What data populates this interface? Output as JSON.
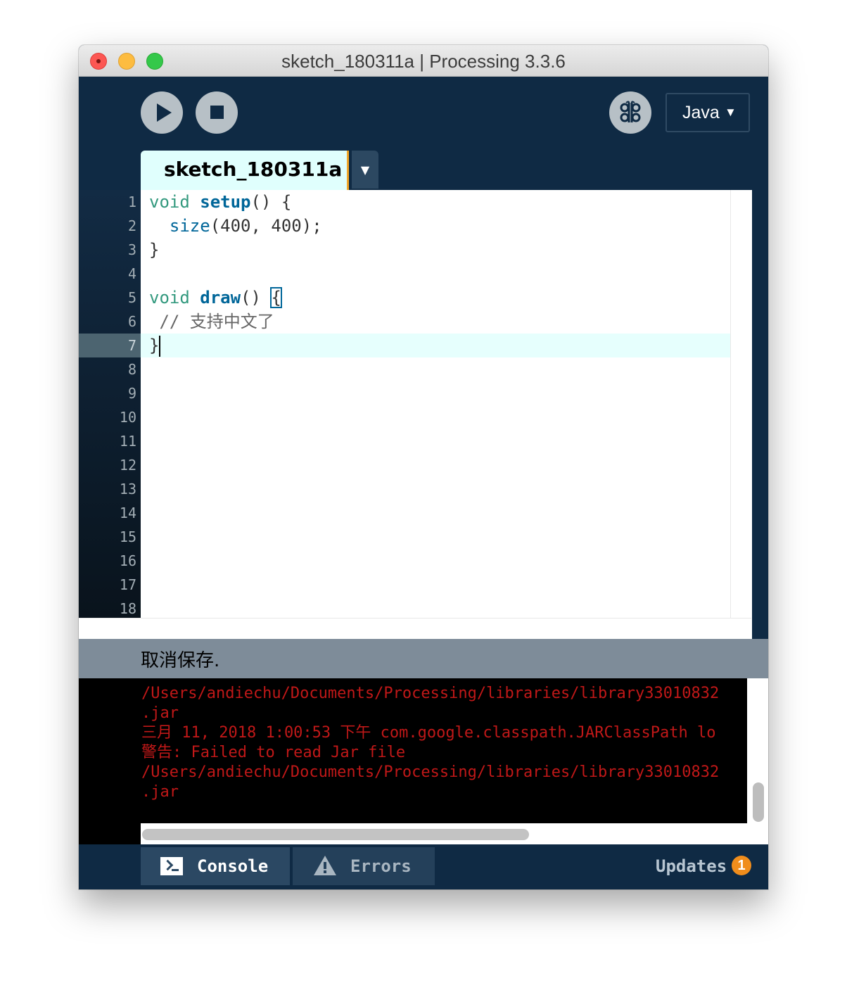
{
  "window": {
    "title": "sketch_180311a | Processing 3.3.6"
  },
  "toolbar": {
    "mode_label": "Java",
    "mode_arrow": "▼"
  },
  "tabs": {
    "active_label": "sketch_180311a",
    "menu_arrow": "▼"
  },
  "editor": {
    "line_numbers": [
      "1",
      "2",
      "3",
      "4",
      "5",
      "6",
      "7",
      "8",
      "9",
      "10",
      "11",
      "12",
      "13",
      "14",
      "15",
      "16",
      "17",
      "18"
    ],
    "active_line": "7",
    "code": {
      "l1_kw": "void",
      "l1_fn": "setup",
      "l1_rest": "() {",
      "l2_fn": "size",
      "l2_rest": "(400, 400);",
      "l3": "}",
      "l5_kw": "void",
      "l5_fn": "draw",
      "l5_rest": "() ",
      "l5_brace": "{",
      "l6_comment": "// 支持中文了",
      "l7": "}"
    }
  },
  "status": {
    "message": "取消保存."
  },
  "console": {
    "lines": [
      "/Users/andiechu/Documents/Processing/libraries/library33010832",
      ".jar",
      "三月 11, 2018 1:00:53 下午 com.google.classpath.JARClassPath lo",
      "警告: Failed to read Jar file",
      "/Users/andiechu/Documents/Processing/libraries/library33010832",
      ".jar"
    ]
  },
  "footer": {
    "console_label": "Console",
    "errors_label": "Errors",
    "updates_label": "Updates",
    "updates_count": "1"
  },
  "colors": {
    "background": "#0f2a44",
    "accent": "#f1a629",
    "error_text": "#c01818",
    "badge": "#f08d1c"
  }
}
